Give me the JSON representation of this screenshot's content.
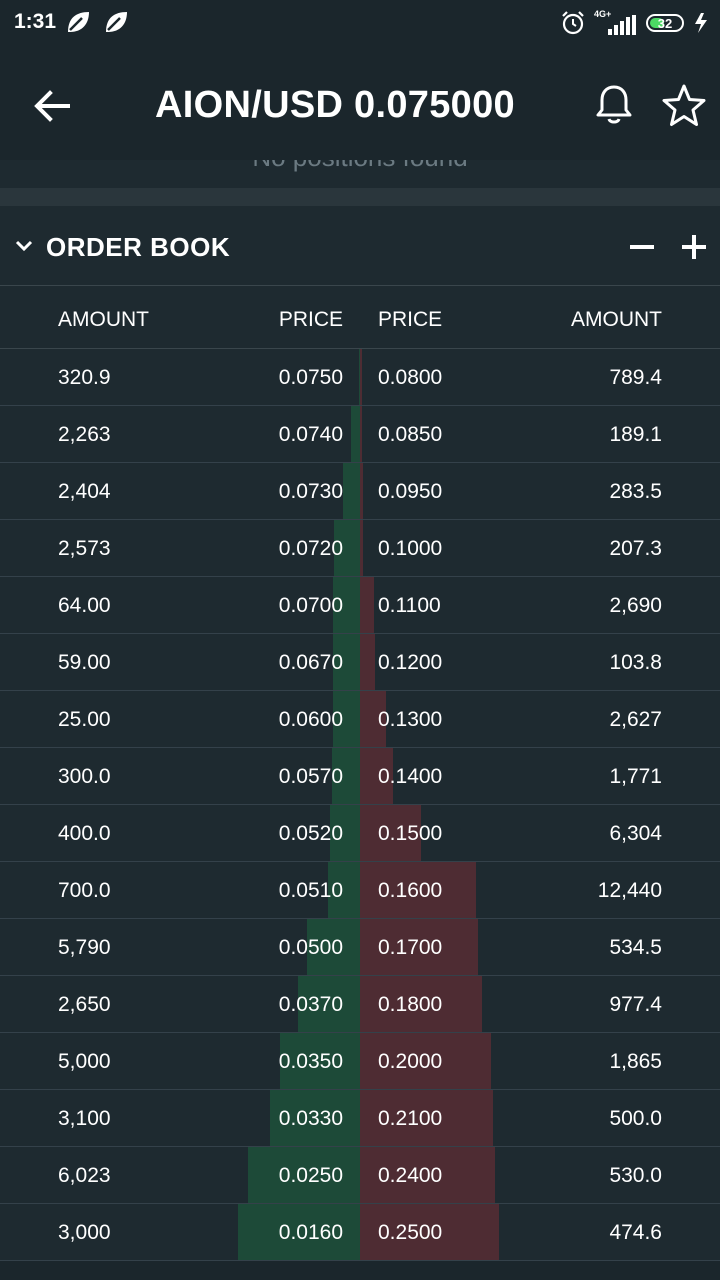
{
  "status_bar": {
    "time": "1:31",
    "network": "4G+",
    "battery": "32"
  },
  "header": {
    "title": "AION/USD 0.075000",
    "back_icon": "arrow-left-icon",
    "bell_icon": "bell-icon",
    "star_icon": "star-outline-icon"
  },
  "positions": {
    "empty_message": "No positions found"
  },
  "order_book": {
    "title": "ORDER BOOK",
    "columns": {
      "bid_amount": "AMOUNT",
      "bid_price": "PRICE",
      "ask_price": "PRICE",
      "ask_amount": "AMOUNT"
    },
    "colors": {
      "bid_bar": "#1d4a38",
      "ask_bar": "#4e2c33"
    },
    "rows": [
      {
        "bid_amount": "320.9",
        "bid_price": "0.0750",
        "ask_price": "0.0800",
        "ask_amount": "789.4",
        "bid_depth": 0.003,
        "ask_depth": 0.005
      },
      {
        "bid_amount": "2,263",
        "bid_price": "0.0740",
        "ask_price": "0.0850",
        "ask_amount": "189.1",
        "bid_depth": 0.025,
        "ask_depth": 0.006
      },
      {
        "bid_amount": "2,404",
        "bid_price": "0.0730",
        "ask_price": "0.0950",
        "ask_amount": "283.5",
        "bid_depth": 0.048,
        "ask_depth": 0.007
      },
      {
        "bid_amount": "2,573",
        "bid_price": "0.0720",
        "ask_price": "0.1000",
        "ask_amount": "207.3",
        "bid_depth": 0.073,
        "ask_depth": 0.008
      },
      {
        "bid_amount": "64.00",
        "bid_price": "0.0700",
        "ask_price": "0.1100",
        "ask_amount": "2,690",
        "bid_depth": 0.074,
        "ask_depth": 0.04
      },
      {
        "bid_amount": "59.00",
        "bid_price": "0.0670",
        "ask_price": "0.1200",
        "ask_amount": "103.8",
        "bid_depth": 0.075,
        "ask_depth": 0.041
      },
      {
        "bid_amount": "25.00",
        "bid_price": "0.0600",
        "ask_price": "0.1300",
        "ask_amount": "2,627",
        "bid_depth": 0.076,
        "ask_depth": 0.072
      },
      {
        "bid_amount": "300.0",
        "bid_price": "0.0570",
        "ask_price": "0.1400",
        "ask_amount": "1,771",
        "bid_depth": 0.079,
        "ask_depth": 0.093
      },
      {
        "bid_amount": "400.0",
        "bid_price": "0.0520",
        "ask_price": "0.1500",
        "ask_amount": "6,304",
        "bid_depth": 0.083,
        "ask_depth": 0.17
      },
      {
        "bid_amount": "700.0",
        "bid_price": "0.0510",
        "ask_price": "0.1600",
        "ask_amount": "12,440",
        "bid_depth": 0.09,
        "ask_depth": 0.322
      },
      {
        "bid_amount": "5,790",
        "bid_price": "0.0500",
        "ask_price": "0.1700",
        "ask_amount": "534.5",
        "bid_depth": 0.146,
        "ask_depth": 0.328
      },
      {
        "bid_amount": "2,650",
        "bid_price": "0.0370",
        "ask_price": "0.1800",
        "ask_amount": "977.4",
        "bid_depth": 0.172,
        "ask_depth": 0.34
      },
      {
        "bid_amount": "5,000",
        "bid_price": "0.0350",
        "ask_price": "0.2000",
        "ask_amount": "1,865",
        "bid_depth": 0.221,
        "ask_depth": 0.363
      },
      {
        "bid_amount": "3,100",
        "bid_price": "0.0330",
        "ask_price": "0.2100",
        "ask_amount": "500.0",
        "bid_depth": 0.251,
        "ask_depth": 0.369
      },
      {
        "bid_amount": "6,023",
        "bid_price": "0.0250",
        "ask_price": "0.2400",
        "ask_amount": "530.0",
        "bid_depth": 0.31,
        "ask_depth": 0.376
      },
      {
        "bid_amount": "3,000",
        "bid_price": "0.0160",
        "ask_price": "0.2500",
        "ask_amount": "474.6",
        "bid_depth": 0.339,
        "ask_depth": 0.387
      }
    ]
  }
}
